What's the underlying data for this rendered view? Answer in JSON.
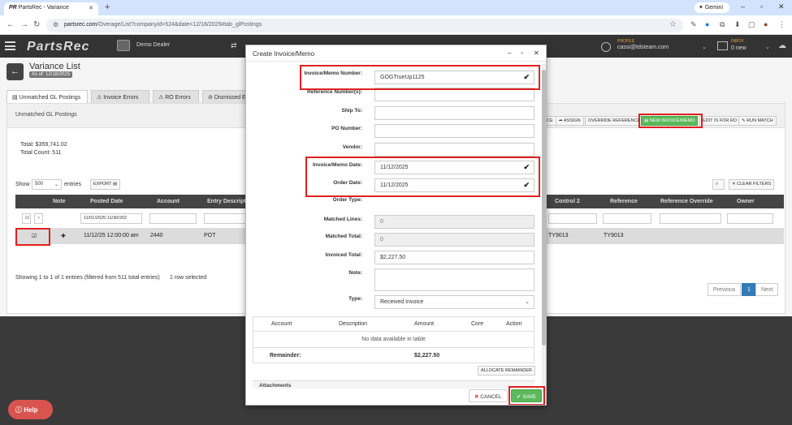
{
  "browser": {
    "tab_title": "PartsRec - Variance",
    "url_host": "partsrec.com",
    "url_path": "/Overage/List?companyId=524&date=12/18/2025#tab_glPostings",
    "gemini_label": "Gemini"
  },
  "app": {
    "logo": "PartsRec",
    "dealer": "Demo Dealer",
    "profile_label": "PROFILE",
    "profile_name": "cassi@tdsteam.com",
    "inbox_label": "INBOX",
    "inbox_count": "0 new"
  },
  "page": {
    "title": "Variance List",
    "as_of": "As of: 12/18/2025",
    "tabs": [
      {
        "label": "Unmatched GL Postings"
      },
      {
        "label": "Invoice Errors"
      },
      {
        "label": "RO Errors"
      },
      {
        "label": "Dismissed E"
      }
    ],
    "panel_title": "Unmatched GL Postings",
    "actions": {
      "ce": "CE",
      "assign": "ASSIGN",
      "override_reference": "OVERRIDE REFERENCE",
      "new_invoice": "NEW INVOICE/MEMO",
      "edit_ro": "EDIT IS FOR RO",
      "run_match": "RUN MATCH"
    },
    "total": "Total: $359,741.02",
    "total_count": "Total Count: 511",
    "show_label": "Show",
    "entries_value": "500",
    "entries_label": "entries",
    "export": "EXPORT",
    "clear_filters": "CLEAR FILTERS",
    "columns": {
      "note": "Note",
      "posted_date": "Posted Date",
      "account": "Account",
      "entry_desc": "Entry Descriptio",
      "control2": "Control 2",
      "reference": "Reference",
      "reference_override": "Reference Override",
      "owner": "Owner"
    },
    "filter_date": "11/01/2025-11/30/202",
    "row": {
      "posted_date": "11/12/25 12:00:00 am",
      "account": "2440",
      "entry_desc": "POT",
      "control2": "TY9013",
      "reference": "TY9013"
    },
    "footer": "Showing 1 to 1 of 1 entries (filtered from 511 total entries)",
    "selected": "1 row selected",
    "pager": {
      "prev": "Previous",
      "page": "1",
      "next": "Next"
    }
  },
  "help": "Help",
  "modal": {
    "title": "Create Invoice/Memo",
    "fields": {
      "invoice_number_label": "Invoice/Memo Number:",
      "invoice_number": "GOGTrueUp1125",
      "refs_label": "Reference Number(s):",
      "ship_to_label": "Ship To:",
      "po_label": "PO Number:",
      "vendor_label": "Vendor:",
      "invoice_date_label": "Invoice/Memo Date:",
      "invoice_date": "11/12/2025",
      "order_date_label": "Order Date:",
      "order_date": "11/12/2025",
      "order_type_label": "Order Type:",
      "matched_lines_label": "Matched Lines:",
      "matched_lines": "0",
      "matched_total_label": "Matched Total:",
      "matched_total": "0",
      "invoiced_total_label": "Invoiced Total:",
      "invoiced_total": "$2,227.50",
      "note_label": "Note:",
      "type_label": "Type:",
      "type_value": "Received Invoice"
    },
    "table": {
      "headers": [
        "Account",
        "Description",
        "Amount",
        "Core",
        "Action"
      ],
      "empty": "No data available in table",
      "remainder_label": "Remainder:",
      "remainder_value": "$2,227.50"
    },
    "allocate": "ALLOCATE REMAINDER",
    "attachments": "Attachments",
    "cancel": "CANCEL",
    "save": "SAVE"
  }
}
